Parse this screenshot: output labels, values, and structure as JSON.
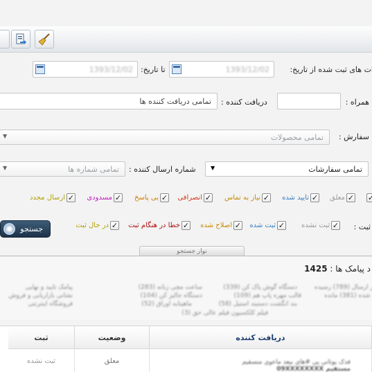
{
  "toolbar": {
    "icons": [
      "edge-button",
      "export-icon",
      "broom-icon"
    ]
  },
  "date_filter": {
    "from_label": "ات های ثبت شده از تاریخ:",
    "from_value": "1393/12/02",
    "to_label": "تا تاریخ:",
    "to_value": "1393/12/02"
  },
  "receiver_filter": {
    "mobile_label": "همراه :",
    "mobile_value": "",
    "receiver_label": "دریافت کننده :",
    "receiver_value": "تمامی دریافت کننده ها"
  },
  "order_filter": {
    "label": "سفارش :",
    "value": "تمامی محصولات"
  },
  "sender_filter": {
    "orders_value": "تمامی سفارشات",
    "sender_label": "شماره ارسال کننده :",
    "sender_value": "تمامی شماره ها"
  },
  "status_checks": {
    "items": [
      {
        "label": "معلق",
        "color": "#999999"
      },
      {
        "label": "تایید شده",
        "color": "#3a7fc2"
      },
      {
        "label": "نیاز به تماس",
        "color": "#c48a00"
      },
      {
        "label": "انصرافی",
        "color": "#d23a1c"
      },
      {
        "label": "بی پاسخ",
        "color": "#d27a00"
      },
      {
        "label": "مسدودی",
        "color": "#c020c0"
      },
      {
        "label": "ارسال مجدد",
        "color": "#b0a000"
      }
    ]
  },
  "register_checks": {
    "label": "ثبت :",
    "items": [
      {
        "label": "ثبت نشده",
        "color": "#999999"
      },
      {
        "label": "ثبت شده",
        "color": "#3a7fc2"
      },
      {
        "label": "اصلاح شده",
        "color": "#c48a00"
      },
      {
        "label": "خطا در هنگام ثبت",
        "color": "#b01010"
      },
      {
        "label": "در حال ثبت",
        "color": "#b0a000"
      }
    ]
  },
  "search": {
    "button_label": "جستجو",
    "tab_label": "نوار جستجو"
  },
  "summary": {
    "label": "د پیامک ها :",
    "count": "1425"
  },
  "table": {
    "headers": [
      "ثبت",
      "وضعیت",
      "دریافت کننده"
    ],
    "row": [
      "ثبت نشده",
      "معلق"
    ]
  }
}
